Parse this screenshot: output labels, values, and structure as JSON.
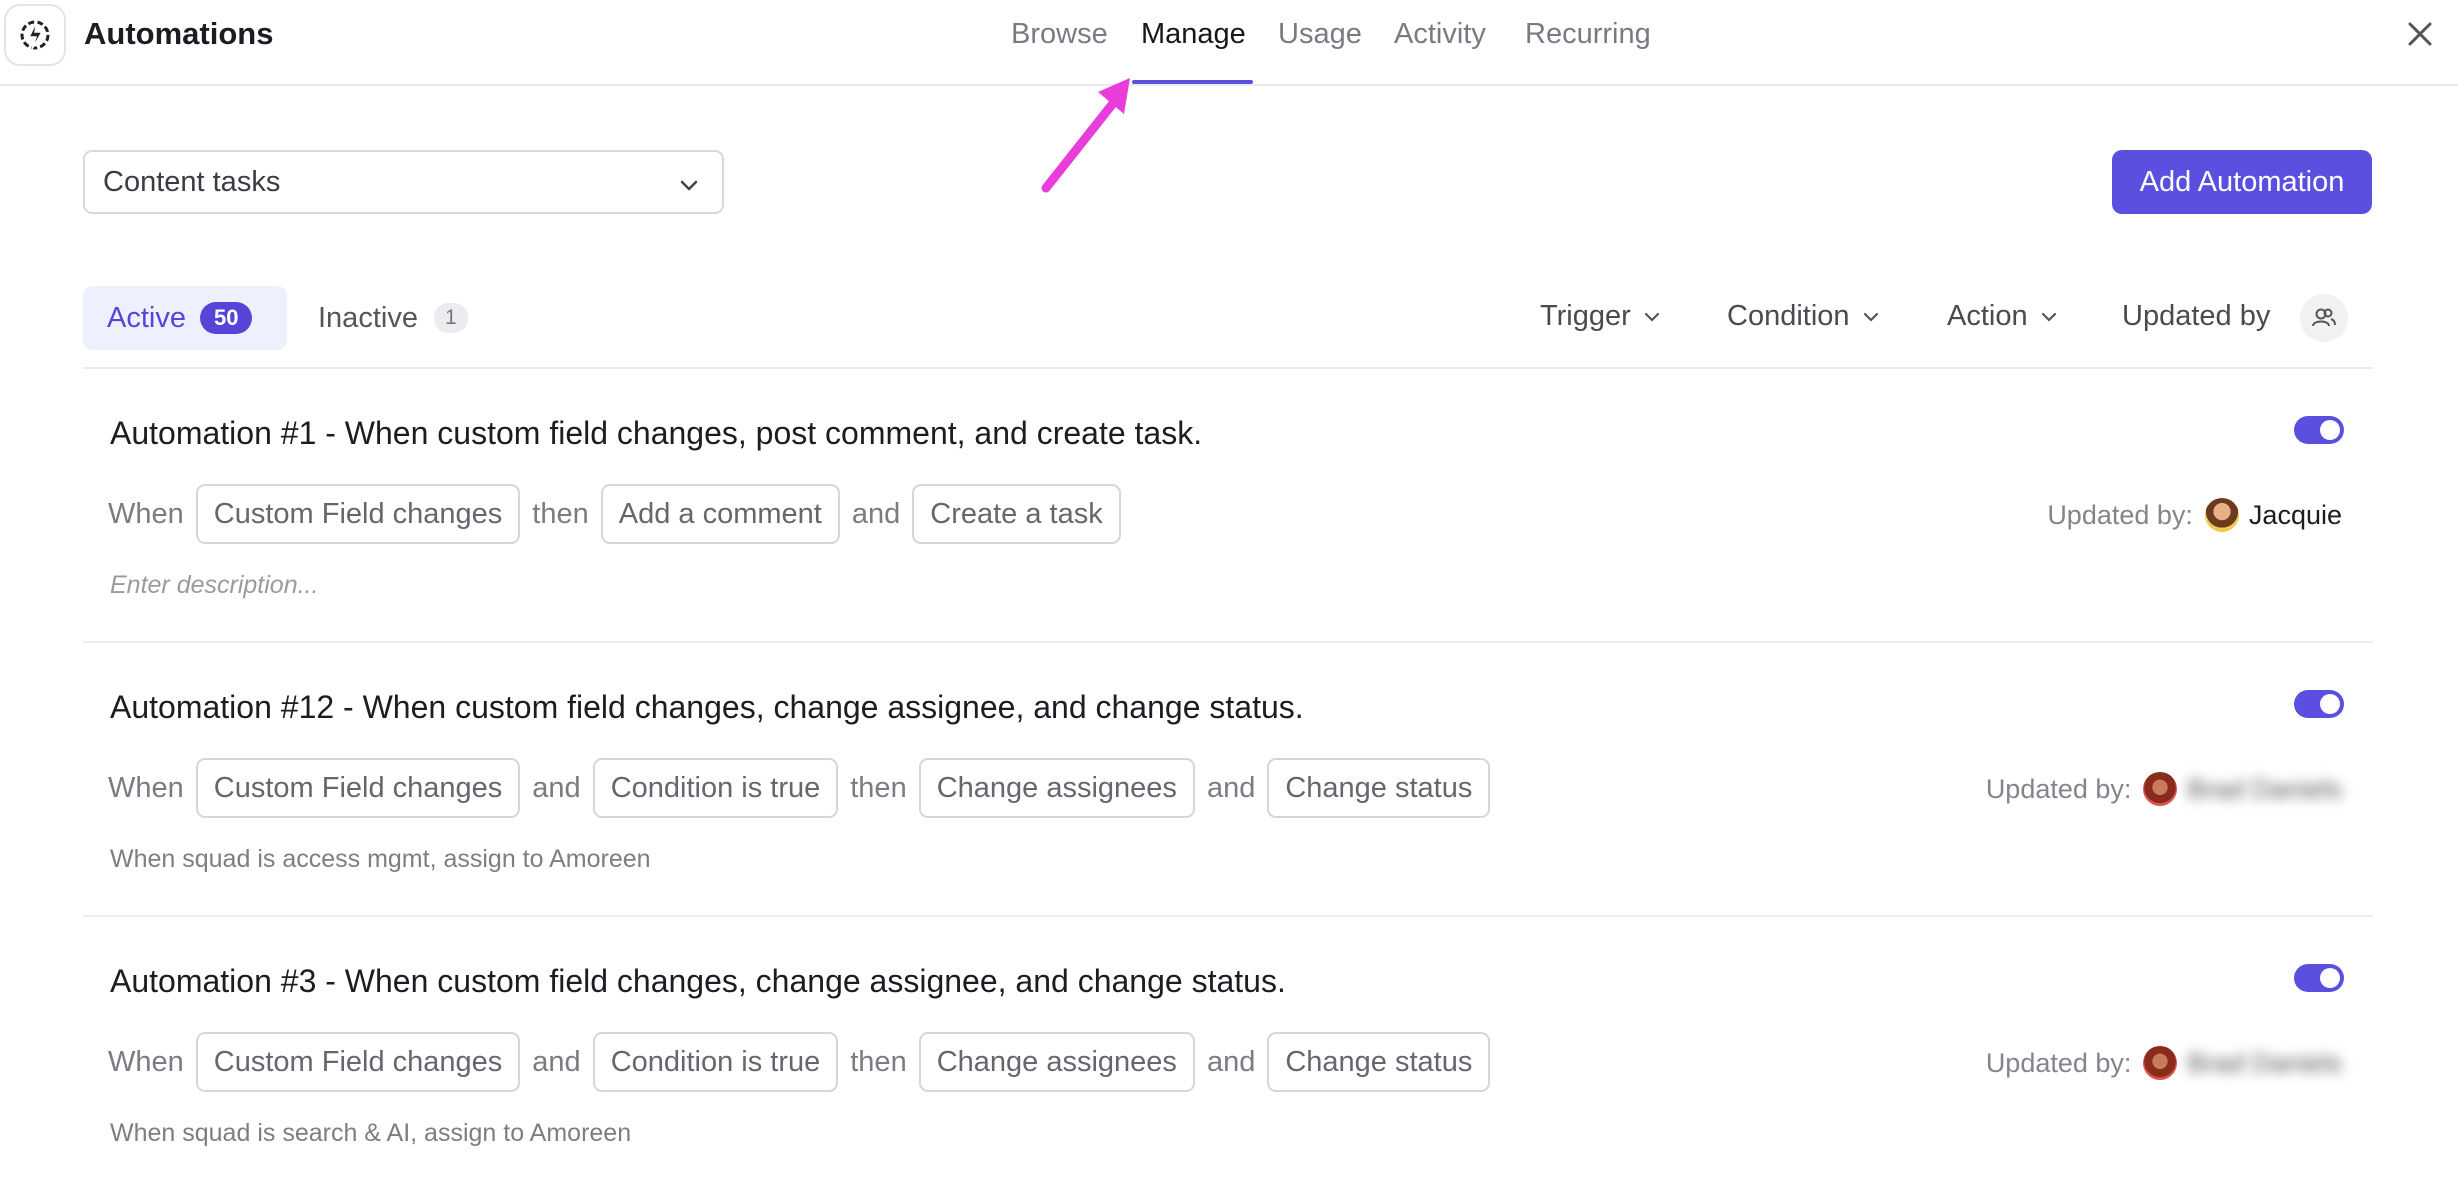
{
  "header": {
    "title": "Automations",
    "tabs": [
      "Browse",
      "Manage",
      "Usage",
      "Activity",
      "Recurring"
    ],
    "active_tab": "Manage"
  },
  "toolbar": {
    "list_select_value": "Content tasks",
    "add_button": "Add Automation"
  },
  "filters": {
    "active_label": "Active",
    "active_count": "50",
    "inactive_label": "Inactive",
    "inactive_count": "1",
    "trigger": "Trigger",
    "condition": "Condition",
    "action": "Action",
    "updated_by": "Updated by"
  },
  "colors": {
    "accent": "#5b4fe0",
    "arrow": "#e83ddb"
  },
  "automations": [
    {
      "title": "Automation #1 - When custom field changes, post comment, and create task.",
      "flow": [
        {
          "type": "word",
          "text": "When"
        },
        {
          "type": "chip",
          "text": "Custom Field changes"
        },
        {
          "type": "word",
          "text": "then"
        },
        {
          "type": "chip",
          "text": "Add a comment"
        },
        {
          "type": "word",
          "text": "and"
        },
        {
          "type": "chip",
          "text": "Create a task"
        }
      ],
      "description": "Enter description...",
      "updated_by_label": "Updated by:",
      "updated_by_name": "Jacquie",
      "enabled": true
    },
    {
      "title": "Automation #12 - When custom field changes, change assignee, and change status.",
      "flow": [
        {
          "type": "word",
          "text": "When"
        },
        {
          "type": "chip",
          "text": "Custom Field changes"
        },
        {
          "type": "word",
          "text": "and"
        },
        {
          "type": "chip",
          "text": "Condition is true"
        },
        {
          "type": "word",
          "text": "then"
        },
        {
          "type": "chip",
          "text": "Change assignees"
        },
        {
          "type": "word",
          "text": "and"
        },
        {
          "type": "chip",
          "text": "Change status"
        }
      ],
      "description": "When squad is access mgmt, assign to Amoreen",
      "updated_by_label": "Updated by:",
      "updated_by_name": "Brad Daniels",
      "enabled": true
    },
    {
      "title": "Automation #3 - When custom field changes, change assignee, and change status.",
      "flow": [
        {
          "type": "word",
          "text": "When"
        },
        {
          "type": "chip",
          "text": "Custom Field changes"
        },
        {
          "type": "word",
          "text": "and"
        },
        {
          "type": "chip",
          "text": "Condition is true"
        },
        {
          "type": "word",
          "text": "then"
        },
        {
          "type": "chip",
          "text": "Change assignees"
        },
        {
          "type": "word",
          "text": "and"
        },
        {
          "type": "chip",
          "text": "Change status"
        }
      ],
      "description": "When squad is search & AI, assign to Amoreen",
      "updated_by_label": "Updated by:",
      "updated_by_name": "Brad Daniels",
      "enabled": true
    }
  ]
}
